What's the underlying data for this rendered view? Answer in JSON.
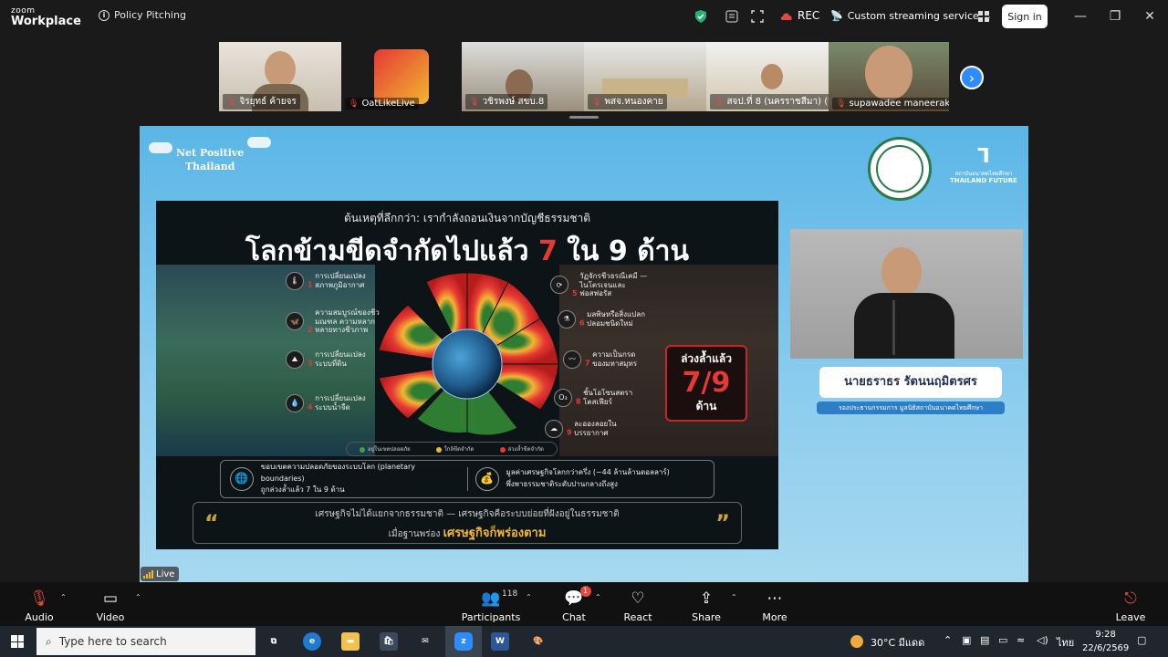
{
  "app": {
    "brand_small": "zoom",
    "brand_big": "Workplace",
    "meeting_title": "Policy Pitching",
    "rec_label": "REC",
    "streaming_label": "Custom streaming service",
    "signin_label": "Sign in"
  },
  "participants": [
    {
      "name": "จิรยุทธ์ ค้ายจร"
    },
    {
      "name": "OatLikeLive"
    },
    {
      "name": "วชิรพงษ์ สขบ.8"
    },
    {
      "name": "พสจ.หนองคาย"
    },
    {
      "name": "สจป.ที่ 8 (นครราชสีมา) (น..."
    },
    {
      "name": "supawadee maneerak"
    }
  ],
  "slide": {
    "org_logo_line1": "Net Positive",
    "org_logo_line2": "Thailand",
    "tff_line1": "สถาบันอนาคตไทยศึกษา",
    "tff_line2": "THAILAND FUTURE",
    "kicker": "ต้นเหตุที่ลึกกว่า: เรากำลังถอนเงินจากบัญชีธรรมชาติ",
    "title_part1": "โลกข้ามขีดจำกัดไปแล้ว",
    "title_num1": "7",
    "title_part2": "ใน 9 ด้าน",
    "boundaries": [
      {
        "num": "1",
        "text": "การเปลี่ยนแปลงสภาพภูมิอากาศ"
      },
      {
        "num": "2",
        "text": "ความสมบูรณ์ของชีวมณฑล ความหลากหลายทางชีวภาพ"
      },
      {
        "num": "3",
        "text": "การเปลี่ยนแปลงระบบที่ดิน"
      },
      {
        "num": "4",
        "text": "การเปลี่ยนแปลงระบบน้ำจืด"
      },
      {
        "num": "5",
        "text": "วัฏจักรชีวธรณีเคมี — ไนโตรเจนและฟอสฟอรัส"
      },
      {
        "num": "6",
        "text": "มลพิษหรือสิ่งแปลกปลอมชนิดใหม่"
      },
      {
        "num": "7",
        "text": "ความเป็นกรดของมหาสมุทร"
      },
      {
        "num": "8",
        "text": "ชั้นโอโซนสตราโตสเฟียร์"
      },
      {
        "num": "9",
        "text": "ละอองลอยในบรรยากาศ"
      }
    ],
    "callout_top": "ล่วงล้ำแล้ว",
    "callout_num": "7/9",
    "callout_bottom": "ด้าน",
    "legend": [
      "อยู่ในเขตปลอดภัย",
      "ใกล้ขีดจำกัด",
      "ล่วงล้ำขีดจำกัด"
    ],
    "info_left_line1": "ขอบเขตความปลอดภัยของระบบโลก (planetary boundaries)",
    "info_left_line2": "ถูกล่วงล้ำแล้ว 7 ใน 9 ด้าน",
    "info_right_line1": "มูลค่าเศรษฐกิจโลกกว่าครึ่ง (~44 ล้านล้านดอลลาร์)",
    "info_right_line2": "พึ่งพาธรรมชาติระดับปานกลางถึงสูง",
    "quote_line1": "เศรษฐกิจไม่ได้แยกจากธรรมชาติ — เศรษฐกิจคือระบบย่อยที่ฝังอยู่ในธรรมชาติ",
    "quote_line2_a": "เมื่อฐานพร่อง",
    "quote_line2_b": "เศรษฐกิจก็พร่องตาม",
    "speaker_name": "นายธราธร รัตนนฤมิตรศร",
    "speaker_role": "รองประธานกรรมการ มูลนิธิสถาบันอนาคตไทยศึกษา",
    "live_label": "Live"
  },
  "toolbar": {
    "audio": "Audio",
    "video": "Video",
    "participants": "Participants",
    "participants_count": "118",
    "chat": "Chat",
    "chat_badge": "1",
    "react": "React",
    "share": "Share",
    "more": "More",
    "leave": "Leave"
  },
  "taskbar": {
    "search_placeholder": "Type here to search",
    "weather": "30°C มีแดด",
    "lang": "ไทย",
    "time": "9:28",
    "date": "22/6/2569"
  },
  "colors": {
    "zoom_blue": "#2d8cff",
    "danger_red": "#e5483c",
    "slide_bg": "#5bb6e6"
  }
}
